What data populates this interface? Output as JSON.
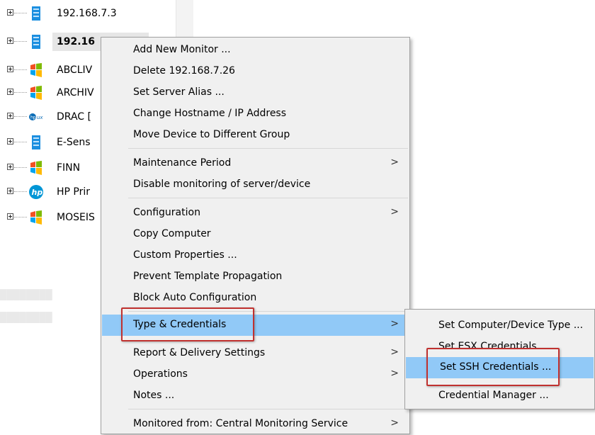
{
  "tree": {
    "items": [
      {
        "label": "192.168.7.3",
        "icon": "server-icon"
      },
      {
        "label": "192.16",
        "icon": "server-icon"
      },
      {
        "label": "ABCLIV",
        "icon": "windows-icon"
      },
      {
        "label": "ARCHIV",
        "icon": "windows-icon"
      },
      {
        "label": "DRAC [",
        "icon": "hpux-icon"
      },
      {
        "label": "E-Sens",
        "icon": "server-icon"
      },
      {
        "label": "FINN",
        "icon": "windows-icon"
      },
      {
        "label": "HP Prir",
        "icon": "hp-icon"
      },
      {
        "label": "MOSEIS",
        "icon": "windows-icon"
      }
    ]
  },
  "context_menu": {
    "items": [
      {
        "label": "Add New Monitor ...",
        "submenu": false
      },
      {
        "label": "Delete 192.168.7.26",
        "submenu": false
      },
      {
        "label": "Set Server Alias ...",
        "submenu": false
      },
      {
        "label": "Change Hostname / IP Address",
        "submenu": false
      },
      {
        "label": "Move Device to Different Group",
        "submenu": false
      },
      {
        "label": "Maintenance Period",
        "submenu": true
      },
      {
        "label": "Disable monitoring of server/device",
        "submenu": false
      },
      {
        "label": "Configuration",
        "submenu": true
      },
      {
        "label": "Copy Computer",
        "submenu": false
      },
      {
        "label": "Custom Properties ...",
        "submenu": false
      },
      {
        "label": "Prevent Template Propagation",
        "submenu": false
      },
      {
        "label": "Block Auto Configuration",
        "submenu": false
      },
      {
        "label": "Type & Credentials",
        "submenu": true,
        "highlighted": true
      },
      {
        "label": "Report & Delivery Settings",
        "submenu": true
      },
      {
        "label": "Operations",
        "submenu": true
      },
      {
        "label": "Notes ...",
        "submenu": false
      },
      {
        "label": "Monitored from: Central Monitoring Service",
        "submenu": true
      }
    ],
    "arrow_glyph": ">"
  },
  "submenu": {
    "items": [
      {
        "label": "Set Computer/Device Type ..."
      },
      {
        "label": "Set ESX Credentials ..."
      },
      {
        "label": "Set SSH Credentials ...",
        "highlighted": true
      },
      {
        "label": "Credential Manager ..."
      }
    ]
  },
  "colors": {
    "menu_bg": "#f0f0f0",
    "highlight": "#91c9f7",
    "annotation_red": "#c0312f",
    "separator": "#d7d7d7"
  }
}
